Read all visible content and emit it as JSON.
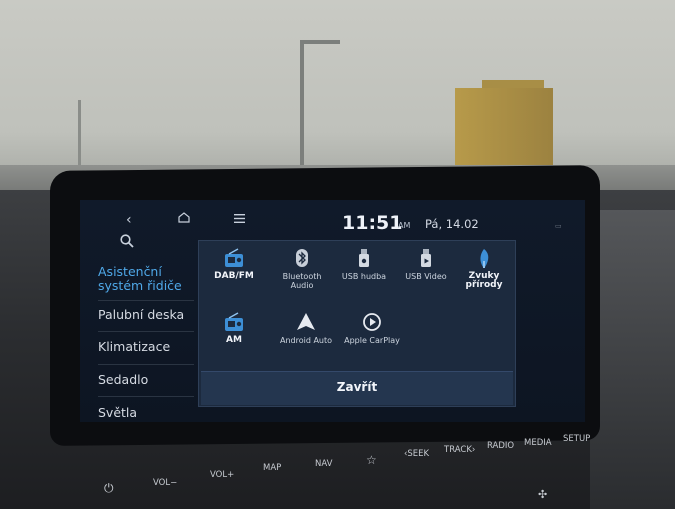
{
  "status_bar": {
    "back_icon": "chevron-left-icon",
    "home_icon": "home-icon",
    "menu_icon": "menu-icon",
    "time": "11:51",
    "ampm": "AM",
    "date": "Pá, 14.02",
    "top_right": "▭"
  },
  "sidebar": {
    "search_icon": "search-icon",
    "items": [
      {
        "label": "Asistenční systém řidiče",
        "active": true
      },
      {
        "label": "Palubní deska"
      },
      {
        "label": "Klimatizace"
      },
      {
        "label": "Sedadlo"
      },
      {
        "label": "Světla"
      }
    ]
  },
  "popup": {
    "apps": [
      {
        "label": "DAB/FM",
        "icon": "radio-icon"
      },
      {
        "label": "Bluetooth Audio",
        "icon": "bluetooth-icon"
      },
      {
        "label": "USB hudba",
        "icon": "usb-icon"
      },
      {
        "label": "USB Video",
        "icon": "usb-icon"
      },
      {
        "label": "Zvuky přírody",
        "icon": "nature-sound-icon"
      },
      {
        "label": "AM",
        "icon": "radio-icon"
      },
      {
        "label": "Android Auto",
        "icon": "android-auto-icon"
      },
      {
        "label": "Apple CarPlay",
        "icon": "carplay-icon"
      }
    ],
    "close_label": "Zavřít"
  },
  "hardware_buttons": {
    "power": "⏻",
    "vol_down": "VOL−",
    "vol_up": "VOL+",
    "map": "MAP",
    "nav": "NAV",
    "star": "☆",
    "seek": "‹SEEK",
    "track": "TRACK›",
    "radio": "RADIO",
    "media": "MEDIA",
    "setup": "SETUP"
  }
}
